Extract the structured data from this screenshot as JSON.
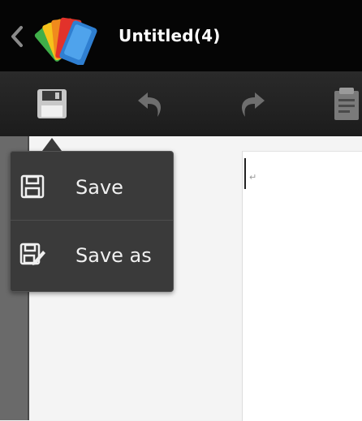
{
  "title_bar": {
    "document_title": "Untitled(4)",
    "back_icon": "chevron-left-icon",
    "logo_icon": "app-logo-icon"
  },
  "toolbar": {
    "buttons": [
      {
        "name": "save",
        "icon": "floppy-disk-icon"
      },
      {
        "name": "undo",
        "icon": "undo-icon"
      },
      {
        "name": "redo",
        "icon": "redo-icon"
      },
      {
        "name": "clipboard",
        "icon": "clipboard-icon"
      }
    ]
  },
  "save_menu": {
    "items": [
      {
        "label": "Save",
        "icon": "save-icon"
      },
      {
        "label": "Save as",
        "icon": "save-as-icon"
      }
    ]
  },
  "document": {
    "paragraph_mark": "↵"
  },
  "colors": {
    "title_bar_bg": "#050505",
    "toolbar_bg": "#222222",
    "menu_bg": "#3a3a3a",
    "icon_gray": "#c8c8c8"
  }
}
